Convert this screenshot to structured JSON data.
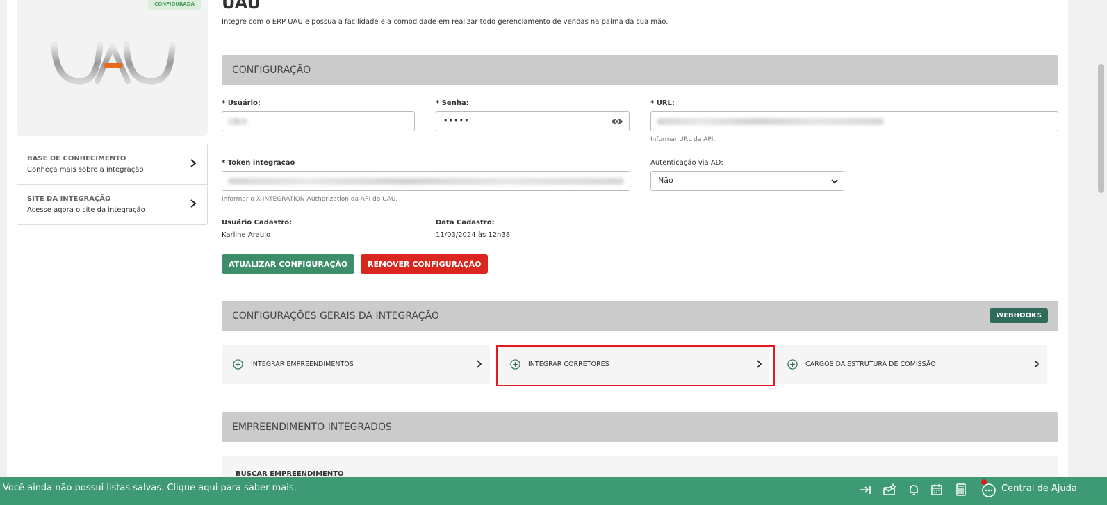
{
  "integration": {
    "title": "UAU",
    "subtitle": "Integre com o ERP UAU e possua a facilidade e a comodidade em realizar todo gerenciamento de vendas na palma da sua mão.",
    "status_badge": "CONFIGURADA"
  },
  "sidebar": {
    "links": [
      {
        "title": "BASE DE CONHECIMENTO",
        "subtitle": "Conheça mais sobre a integração"
      },
      {
        "title": "SITE DA INTEGRAÇÃO",
        "subtitle": "Acesse agora o site da integração"
      }
    ]
  },
  "config": {
    "section_title": "CONFIGURAÇÃO",
    "usuario_label": "* Usuário:",
    "senha_label": "* Senha:",
    "senha_value": "•••••",
    "url_label": "* URL:",
    "url_helper": "Informar URL da API.",
    "token_label": "* Token integracao",
    "token_helper": "Informar o X-INTEGRATION-Authorization da API do UAU.",
    "ad_label": "Autenticação via AD:",
    "ad_value": "Não",
    "usuario_cadastro_label": "Usuário Cadastro:",
    "usuario_cadastro_value": "Karline Araujo",
    "data_cadastro_label": "Data Cadastro:",
    "data_cadastro_value": "11/03/2024 às 12h38",
    "update_button": "ATUALIZAR CONFIGURAÇÃO",
    "remove_button": "REMOVER CONFIGURAÇÃO"
  },
  "general": {
    "section_title": "CONFIGURAÇÕES GERAIS DA INTEGRAÇÃO",
    "webhooks_button": "WEBHOOKS",
    "cards": [
      {
        "label": "INTEGRAR EMPREENDIMENTOS"
      },
      {
        "label": "INTEGRAR CORRETORES"
      },
      {
        "label": "CARGOS DA ESTRUTURA DE COMISSÃO"
      }
    ]
  },
  "empreendimentos": {
    "section_title": "EMPREENDIMENTO INTEGRADOS",
    "search_label": "BUSCAR EMPREENDIMENTO"
  },
  "bottom_bar": {
    "message": "Você ainda não possui listas salvas. Clique aqui para saber mais.",
    "help_label": "Central de Ajuda",
    "icons": [
      "collapse-icon",
      "mail-star-icon",
      "bell-icon",
      "calendar-icon",
      "calculator-icon",
      "chat-icon"
    ]
  },
  "colors": {
    "accent_green": "#3d8d69",
    "danger_red": "#d9261e",
    "section_gray": "#cbcbcb",
    "bottom_bar": "#3d9a74",
    "highlight_red": "#e3191e"
  }
}
